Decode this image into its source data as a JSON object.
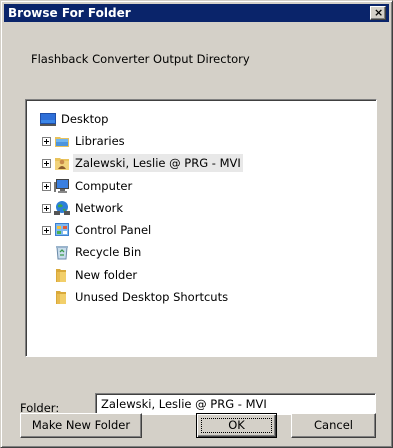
{
  "window": {
    "title": "Browse For Folder",
    "close_label": "×"
  },
  "description": "Flashback Converter Output Directory",
  "tree": {
    "items": [
      {
        "label": "Desktop",
        "icon": "desktop-icon",
        "expandable": false,
        "selected": false
      },
      {
        "label": "Libraries",
        "icon": "libraries-icon",
        "expandable": true,
        "selected": false
      },
      {
        "label": "Zalewski, Leslie @ PRG - MVI",
        "icon": "user-folder-icon",
        "expandable": true,
        "selected": true
      },
      {
        "label": "Computer",
        "icon": "computer-icon",
        "expandable": true,
        "selected": false
      },
      {
        "label": "Network",
        "icon": "network-icon",
        "expandable": true,
        "selected": false
      },
      {
        "label": "Control Panel",
        "icon": "control-panel-icon",
        "expandable": true,
        "selected": false
      },
      {
        "label": "Recycle Bin",
        "icon": "recycle-bin-icon",
        "expandable": false,
        "selected": false
      },
      {
        "label": "New folder",
        "icon": "folder-icon",
        "expandable": false,
        "selected": false
      },
      {
        "label": "Unused Desktop Shortcuts",
        "icon": "folder-icon",
        "expandable": false,
        "selected": false
      }
    ]
  },
  "folder_field": {
    "label": "Folder:",
    "value": "Zalewski, Leslie @ PRG - MVI"
  },
  "buttons": {
    "make_new_folder": "Make New Folder",
    "ok": "OK",
    "cancel": "Cancel"
  }
}
